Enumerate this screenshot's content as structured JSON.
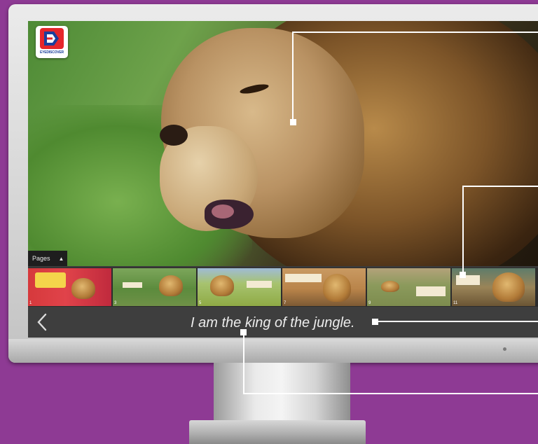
{
  "brand": {
    "logo_text": "EYEDISCOVER",
    "accent": "#e5262b",
    "primary": "#1b3f9c"
  },
  "pages_toggle": {
    "label": "Pages",
    "icon": "chevron-up-icon"
  },
  "thumbnails": [
    {
      "page": "1",
      "label": ""
    },
    {
      "page": "3",
      "label": ""
    },
    {
      "page": "5",
      "label": ""
    },
    {
      "page": "7",
      "label": ""
    },
    {
      "page": "9",
      "label": ""
    },
    {
      "page": "11",
      "label": ""
    }
  ],
  "caption": {
    "text": "I am the king of the jungle."
  },
  "navigation": {
    "back_icon": "chevron-left-icon"
  },
  "colors": {
    "background": "#8e3a94",
    "caption_bar": "#3e3e3e",
    "callout": "#ffffff"
  }
}
